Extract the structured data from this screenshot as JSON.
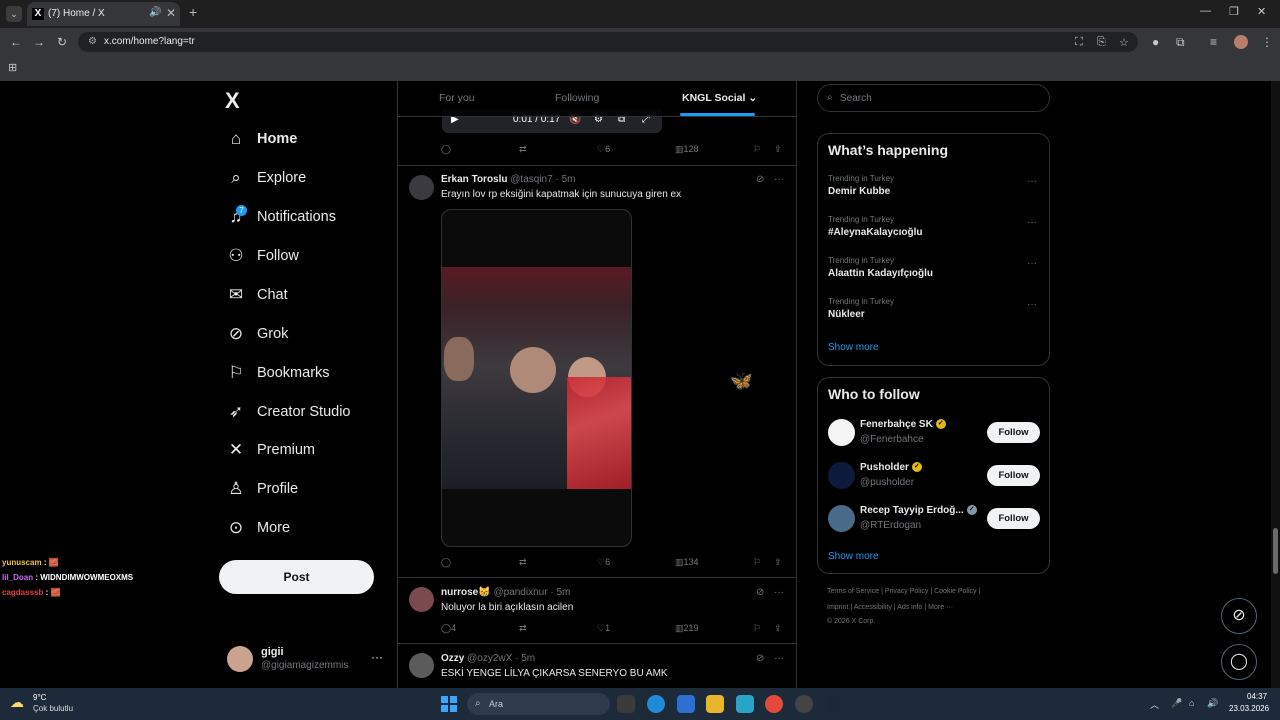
{
  "browser": {
    "tab_title": "(7) Home / X",
    "url": "x.com/home?lang=tr",
    "tab_favicon": "X"
  },
  "sidebar": {
    "logo": "X",
    "items": [
      {
        "label": "Home",
        "icon": "home-icon",
        "glyph": "⌂"
      },
      {
        "label": "Explore",
        "icon": "search-icon",
        "glyph": "⌕"
      },
      {
        "label": "Notifications",
        "icon": "bell-icon",
        "glyph": "🔔"
      },
      {
        "label": "Follow",
        "icon": "add-person-icon",
        "glyph": "👤"
      },
      {
        "label": "Chat",
        "icon": "mail-icon",
        "glyph": "✉"
      },
      {
        "label": "Grok",
        "icon": "grok-icon",
        "glyph": "⊘"
      },
      {
        "label": "Bookmarks",
        "icon": "bookmark-icon",
        "glyph": "⚐"
      },
      {
        "label": "Creator Studio",
        "icon": "rocket-icon",
        "glyph": "🚀"
      },
      {
        "label": "Premium",
        "icon": "x-premium-icon",
        "glyph": "✕"
      },
      {
        "label": "Profile",
        "icon": "person-icon",
        "glyph": "👤"
      },
      {
        "label": "More",
        "icon": "more-circle-icon",
        "glyph": "⋯"
      }
    ],
    "notifications_badge": "7",
    "post_label": "Post",
    "user": {
      "name": "gigii",
      "handle": "@gigiamagizemmis"
    }
  },
  "chat_overlay": [
    {
      "name": "yunuscam",
      "msg": ": 🧱"
    },
    {
      "name": "lil_Doan",
      "msg": ": WIDNDIMWOWMEOXMS"
    },
    {
      "name": "cagdasssb",
      "msg": ": 🧱"
    }
  ],
  "timeline": {
    "tabs": [
      "For you",
      "Following",
      "KNGL Social"
    ],
    "active_tab": "KNGL Social",
    "video_time": "0:01 / 0:17",
    "tweets": [
      {
        "replies": "",
        "retweets": "",
        "likes": "6",
        "views": "128"
      },
      {
        "name": "Erkan Toroslu",
        "handle": "@tasqin7",
        "time": "5m",
        "text": "Erayın lov rp eksiğini kapatmak için sunucuya giren ex",
        "replies": "",
        "retweets": "",
        "likes": "6",
        "views": "134"
      },
      {
        "name": "nurrose😸",
        "handle": "@pandixnur",
        "time": "5m",
        "text": "Noluyor la biri açıklasın acilen",
        "replies": "4",
        "retweets": "",
        "likes": "1",
        "views": "219"
      },
      {
        "name": "Ozzy",
        "handle": "@ozy2wX",
        "time": "5m",
        "text": "ESKİ YENGE LİLYA ÇIKARSA SENERYO BU AMK"
      }
    ]
  },
  "right": {
    "search_placeholder": "Search",
    "happening_title": "What’s happening",
    "trends": [
      {
        "context": "Trending in Turkey",
        "name": "Demir Kubbe"
      },
      {
        "context": "Trending in Turkey",
        "name": "#AleynaKalaycıoğlu"
      },
      {
        "context": "Trending in Turkey",
        "name": "Alaattin Kadayıfçıoğlu"
      },
      {
        "context": "Trending in Turkey",
        "name": "Nükleer"
      }
    ],
    "show_more": "Show more",
    "wtf_title": "Who to follow",
    "who_to_follow": [
      {
        "name": "Fenerbahçe SK",
        "handle": "@Fenerbahce",
        "follow": "Follow",
        "badge": "gold"
      },
      {
        "name": "Pusholder",
        "handle": "@pusholder",
        "follow": "Follow",
        "badge": "gold"
      },
      {
        "name": "Recep Tayyip Erdoğ...",
        "handle": "@RTErdogan",
        "follow": "Follow",
        "badge": "grey"
      }
    ],
    "footer_line1": "Terms of Service  |  Privacy Policy  |  Cookie Policy  |",
    "footer_line2": "Imprint  |  Accessibility  |  Ads info  |  More ···",
    "footer_line3": "© 2026 X Corp."
  },
  "taskbar": {
    "weather_temp": "9°C",
    "weather_desc": "Çok bulutlu",
    "search_placeholder": "Ara",
    "time": "04:37",
    "date": "23.03.2026"
  },
  "colors": {
    "accent": "#1d9bf0",
    "background": "#000000",
    "border": "#2f3336",
    "muted_text": "#71767b"
  }
}
